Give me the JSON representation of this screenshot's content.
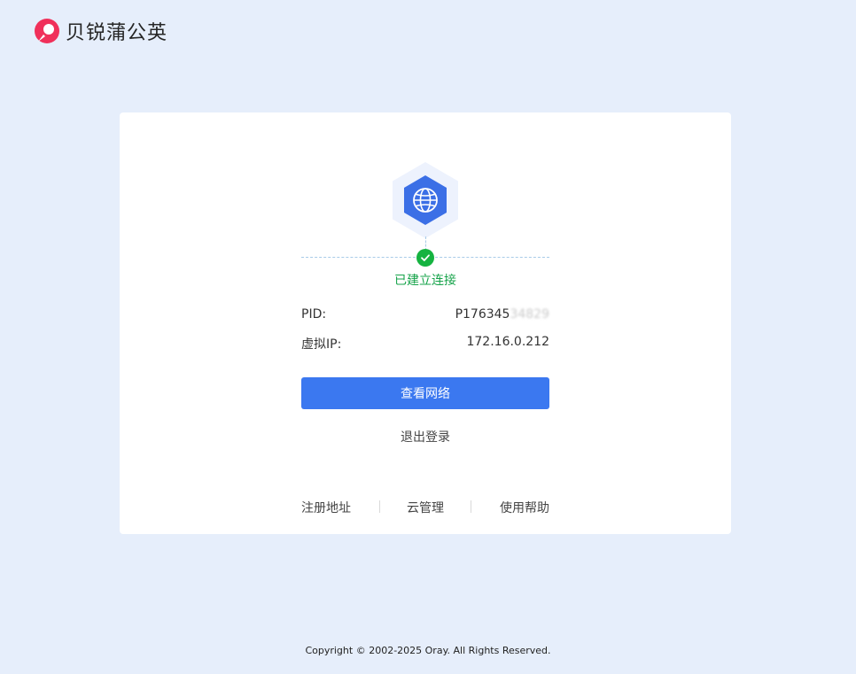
{
  "header": {
    "brand_name": "贝锐蒲公英",
    "brand_color": "#f0305a"
  },
  "status": {
    "icon": "globe-icon",
    "text": "已建立连接",
    "color": "#16a34a"
  },
  "info": {
    "pid_label": "PID:",
    "pid_value": "P176345",
    "pid_value_masked": "34829",
    "ip_label": "虚拟IP:",
    "ip_value": "172.16.0.212"
  },
  "actions": {
    "view_network_label": "查看网络",
    "logout_label": "退出登录",
    "primary_color": "#3b78f0"
  },
  "footer_links": {
    "register_address": "注册地址",
    "cloud_management": "云管理",
    "help": "使用帮助"
  },
  "copyright": "Copyright © 2002-2025 Oray. All Rights Reserved."
}
